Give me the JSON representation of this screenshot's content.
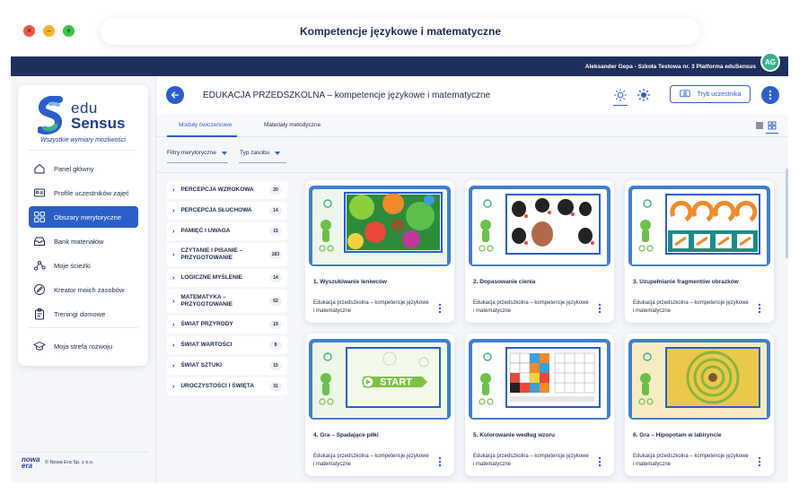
{
  "browser": {
    "title": "Kompetencje językowe i matematyczne",
    "controls": [
      "×",
      "–",
      "+"
    ]
  },
  "topbar": {
    "user_info": "Aleksander Gepa - Szkoła Testowa nr. 3 Platforma eduSensus",
    "avatar": "AG"
  },
  "sidebar": {
    "logo_top": "edu",
    "logo_bottom": "Sensus",
    "tagline": "Wszystkie wymiary możliwości",
    "items": [
      {
        "label": "Panel główny",
        "icon": "home-icon"
      },
      {
        "label": "Profile uczestników zajęć",
        "icon": "id-card-icon"
      },
      {
        "label": "Obszary merytoryczne",
        "icon": "grid-icon",
        "active": true
      },
      {
        "label": "Bank materiałów",
        "icon": "tray-icon"
      },
      {
        "label": "Moje ścieżki",
        "icon": "path-icon"
      },
      {
        "label": "Kreator moich zasobów",
        "icon": "pencil-icon"
      },
      {
        "label": "Treningi domowe",
        "icon": "clipboard-icon"
      },
      {
        "label": "Moja strefa rozwoju",
        "icon": "graduation-icon"
      }
    ],
    "footer_logo": "nowa era",
    "footer_text": "© Nowa Era Sp. z o.o."
  },
  "header": {
    "title": "EDUKACJA PRZEDSZKOLNA – kompetencje językowe i matematyczne",
    "student_mode": "Tryb uczestnika"
  },
  "tabs": [
    {
      "label": "Moduły ćwiczeniowe",
      "active": true
    },
    {
      "label": "Materiały metodyczne",
      "active": false
    }
  ],
  "filters": [
    {
      "label": "Filtry merytoryczne"
    },
    {
      "label": "Typ zasobu"
    }
  ],
  "categories": [
    {
      "label": "PERCEPCJA WZROKOWA",
      "count": "20"
    },
    {
      "label": "PERCEPCJA SŁUCHOWA",
      "count": "14"
    },
    {
      "label": "PAMIĘĆ I UWAGA",
      "count": "15"
    },
    {
      "label": "CZYTANIE I PISANIE – PRZYGOTOWANIE",
      "count": "183"
    },
    {
      "label": "LOGICZNE MYŚLENIE",
      "count": "14"
    },
    {
      "label": "MATEMATYKA – PRZYGOTOWANIE",
      "count": "62"
    },
    {
      "label": "ŚWIAT PRZYRODY",
      "count": "19"
    },
    {
      "label": "ŚWIAT WARTOŚCI",
      "count": "8"
    },
    {
      "label": "ŚWIAT SZTUKI",
      "count": "15"
    },
    {
      "label": "UROCZYSTOŚCI I ŚWIĘTA",
      "count": "31"
    }
  ],
  "cards": [
    {
      "title": "1. Wyszukiwanie leniwców",
      "desc": "Edukacja przedszkolna – kompetencje językowe i matematyczne"
    },
    {
      "title": "2. Dopasowanie cienia",
      "desc": "Edukacja przedszkolna – kompetencje językowe i matematyczne"
    },
    {
      "title": "3. Uzupełnianie fragmentów obrazków",
      "desc": "Edukacja przedszkolna – kompetencje językowe i matematyczne"
    },
    {
      "title": "4. Gra – Spadające piłki",
      "desc": "Edukacja przedszkolna – kompetencje językowe i matematyczne",
      "thumb_text": "START"
    },
    {
      "title": "5. Kolorowanie według wzoru",
      "desc": "Edukacja przedszkolna – kompetencje językowe i matematyczne"
    },
    {
      "title": "6. Gra – Hipopotam w labiryncie",
      "desc": "Edukacja przedszkolna – kompetencje językowe i matematyczne"
    }
  ],
  "colors": {
    "accent": "#2a5fc9",
    "topstrip": "#1f2f5c",
    "avatar": "#3cb08e",
    "thumb_frame": "#3f7fcc"
  }
}
